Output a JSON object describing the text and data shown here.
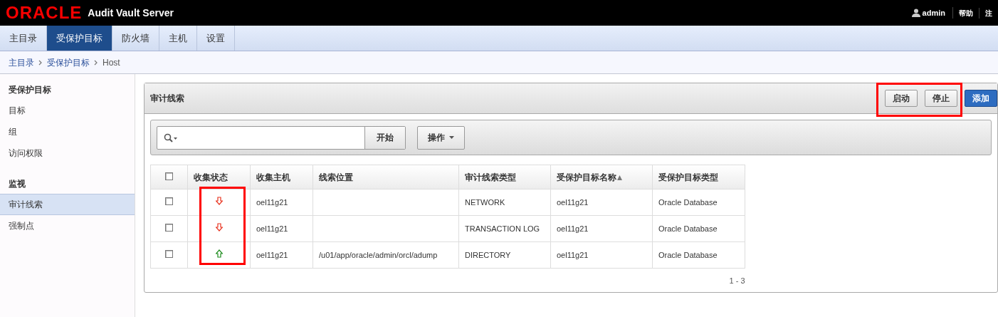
{
  "header": {
    "logo": "ORACLE",
    "product": "Audit Vault Server",
    "user": "admin",
    "links": [
      "帮助",
      "注"
    ]
  },
  "tabs": [
    {
      "label": "主目录",
      "selected": false
    },
    {
      "label": "受保护目标",
      "selected": true
    },
    {
      "label": "防火墙",
      "selected": false
    },
    {
      "label": "主机",
      "selected": false
    },
    {
      "label": "设置",
      "selected": false
    }
  ],
  "breadcrumb": {
    "links": [
      "主目录",
      "受保护目标"
    ],
    "current": "Host"
  },
  "sidebar": {
    "sections": [
      {
        "title": "受保护目标",
        "items": [
          {
            "label": "目标",
            "selected": false
          },
          {
            "label": "组",
            "selected": false
          },
          {
            "label": "访问权限",
            "selected": false
          }
        ]
      },
      {
        "title": "监视",
        "items": [
          {
            "label": "审计线索",
            "selected": true
          },
          {
            "label": "强制点",
            "selected": false
          }
        ]
      }
    ]
  },
  "panel": {
    "title": "审计线索",
    "buttons": [
      {
        "label": "启动",
        "kind": "plain"
      },
      {
        "label": "停止",
        "kind": "plain"
      },
      {
        "label": "添加",
        "kind": "primary"
      }
    ],
    "toolbar": {
      "go": "开始",
      "actions": "操作"
    },
    "table": {
      "header_checked": false,
      "status_column": "收集状态",
      "columns": [
        {
          "label": "收集主机",
          "sorted": false
        },
        {
          "label": "线索位置",
          "sorted": false
        },
        {
          "label": "审计线索类型",
          "sorted": false
        },
        {
          "label": "受保护目标名称",
          "sorted": true
        },
        {
          "label": "受保护目标类型",
          "sorted": false
        }
      ],
      "rows": [
        {
          "checked": false,
          "collecting": false,
          "cells": [
            "oel11g21",
            "",
            "NETWORK",
            "oel11g21",
            "Oracle Database"
          ]
        },
        {
          "checked": false,
          "collecting": false,
          "cells": [
            "oel11g21",
            "",
            "TRANSACTION LOG",
            "oel11g21",
            "Oracle Database"
          ]
        },
        {
          "checked": false,
          "collecting": true,
          "cells": [
            "oel11g21",
            "/u01/app/oracle/admin/orcl/adump",
            "DIRECTORY",
            "oel11g21",
            "Oracle Database"
          ]
        }
      ],
      "range": "1 - 3"
    }
  }
}
